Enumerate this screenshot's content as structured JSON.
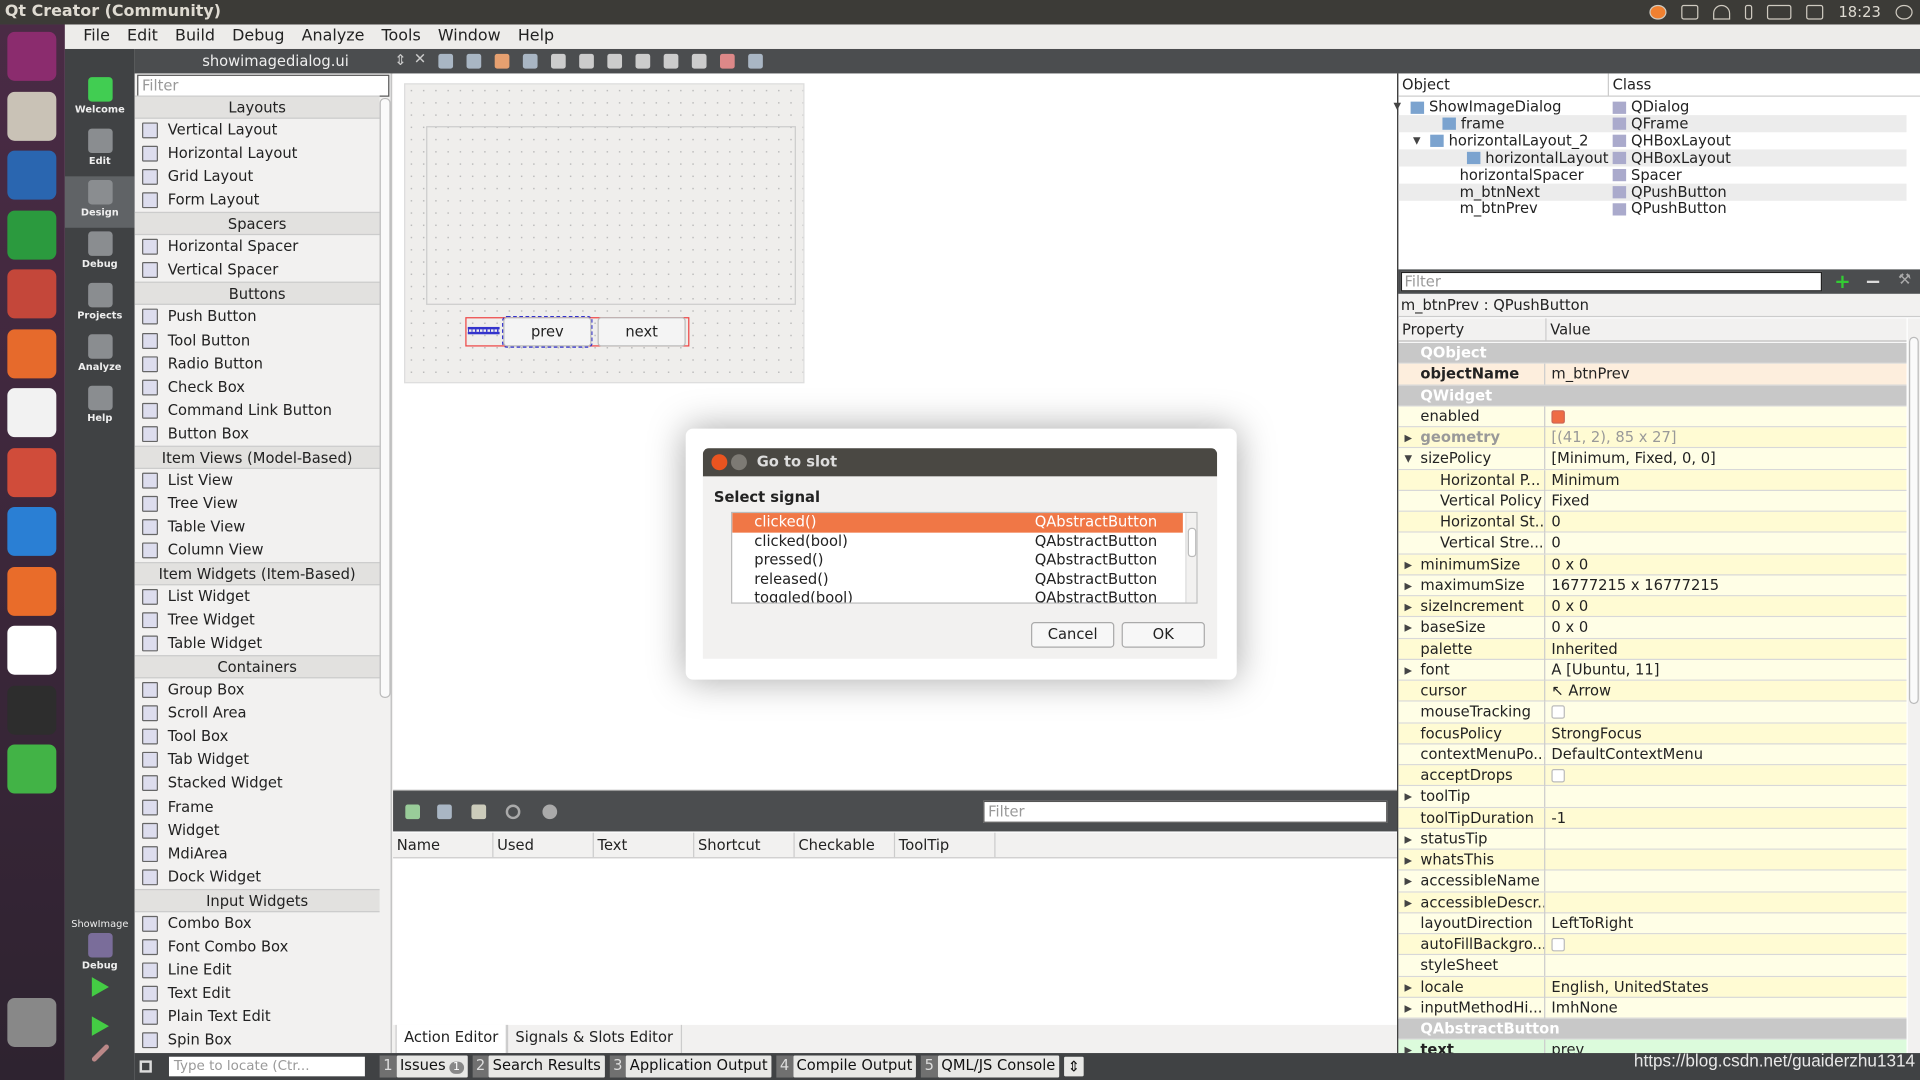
{
  "window": {
    "title": "Qt Creator (Community)",
    "clock": "18:23"
  },
  "launcher": [
    "ubuntu-dash",
    "files",
    "writer",
    "calc",
    "impress",
    "software-center",
    "amazon",
    "system-settings",
    "vscode",
    "ubuntu-updates",
    "chrome",
    "terminal",
    "qt-creator",
    "trash"
  ],
  "menu": [
    "File",
    "Edit",
    "Build",
    "Debug",
    "Analyze",
    "Tools",
    "Window",
    "Help"
  ],
  "modes": [
    "Welcome",
    "Edit",
    "Design",
    "Debug",
    "Projects",
    "Analyze",
    "Help"
  ],
  "target": {
    "project": "ShowImage",
    "config": "Debug"
  },
  "editor": {
    "document": "showimagedialog.ui"
  },
  "widgetbox": {
    "filter_placeholder": "Filter",
    "rows": [
      {
        "cat": "Layouts"
      },
      {
        "label": "Vertical Layout"
      },
      {
        "label": "Horizontal Layout"
      },
      {
        "label": "Grid Layout"
      },
      {
        "label": "Form Layout"
      },
      {
        "cat": "Spacers"
      },
      {
        "label": "Horizontal Spacer"
      },
      {
        "label": "Vertical Spacer"
      },
      {
        "cat": "Buttons"
      },
      {
        "label": "Push Button"
      },
      {
        "label": "Tool Button"
      },
      {
        "label": "Radio Button"
      },
      {
        "label": "Check Box"
      },
      {
        "label": "Command Link Button"
      },
      {
        "label": "Button Box"
      },
      {
        "cat": "Item Views (Model-Based)"
      },
      {
        "label": "List View"
      },
      {
        "label": "Tree View"
      },
      {
        "label": "Table View"
      },
      {
        "label": "Column View"
      },
      {
        "cat": "Item Widgets (Item-Based)"
      },
      {
        "label": "List Widget"
      },
      {
        "label": "Tree Widget"
      },
      {
        "label": "Table Widget"
      },
      {
        "cat": "Containers"
      },
      {
        "label": "Group Box"
      },
      {
        "label": "Scroll Area"
      },
      {
        "label": "Tool Box"
      },
      {
        "label": "Tab Widget"
      },
      {
        "label": "Stacked Widget"
      },
      {
        "label": "Frame"
      },
      {
        "label": "Widget"
      },
      {
        "label": "MdiArea"
      },
      {
        "label": "Dock Widget"
      },
      {
        "cat": "Input Widgets"
      },
      {
        "label": "Combo Box"
      },
      {
        "label": "Font Combo Box"
      },
      {
        "label": "Line Edit"
      },
      {
        "label": "Text Edit"
      },
      {
        "label": "Plain Text Edit"
      },
      {
        "label": "Spin Box"
      }
    ]
  },
  "form": {
    "prev": "prev",
    "next": "next"
  },
  "action_editor": {
    "filter_placeholder": "Filter",
    "columns": [
      "Name",
      "Used",
      "Text",
      "Shortcut",
      "Checkable",
      "ToolTip"
    ],
    "tabs": [
      "Action Editor",
      "Signals & Slots Editor"
    ]
  },
  "object_inspector": {
    "columns": [
      "Object",
      "Class"
    ],
    "rows": [
      {
        "object": "ShowImageDialog",
        "class": "QDialog",
        "depth": 0,
        "expanded": true
      },
      {
        "object": "frame",
        "class": "QFrame",
        "depth": 1
      },
      {
        "object": "horizontalLayout_2",
        "class": "QHBoxLayout",
        "depth": 1,
        "expanded": true
      },
      {
        "object": "horizontalLayout",
        "class": "QHBoxLayout",
        "depth": 2
      },
      {
        "object": "horizontalSpacer",
        "class": "Spacer",
        "depth": 2
      },
      {
        "object": "m_btnNext",
        "class": "QPushButton",
        "depth": 2
      },
      {
        "object": "m_btnPrev",
        "class": "QPushButton",
        "depth": 2
      }
    ]
  },
  "property_editor": {
    "filter_placeholder": "Filter",
    "selected": "m_btnPrev : QPushButton",
    "columns": [
      "Property",
      "Value"
    ],
    "rows": [
      {
        "group": "QObject"
      },
      {
        "name": "objectName",
        "value": "m_btnPrev",
        "bold": true
      },
      {
        "group": "QWidget"
      },
      {
        "name": "enabled",
        "check": true
      },
      {
        "name": "geometry",
        "value": "[(41, 2), 85 x 27]",
        "arrow": "right",
        "dim": true
      },
      {
        "name": "sizePolicy",
        "value": "[Minimum, Fixed, 0, 0]",
        "arrow": "down"
      },
      {
        "name": "Horizontal P...",
        "value": "Minimum",
        "sub": true
      },
      {
        "name": "Vertical Policy",
        "value": "Fixed",
        "sub": true
      },
      {
        "name": "Horizontal St...",
        "value": "0",
        "sub": true
      },
      {
        "name": "Vertical Stre...",
        "value": "0",
        "sub": true
      },
      {
        "name": "minimumSize",
        "value": "0 x 0",
        "arrow": "right"
      },
      {
        "name": "maximumSize",
        "value": "16777215 x 16777215",
        "arrow": "right"
      },
      {
        "name": "sizeIncrement",
        "value": "0 x 0",
        "arrow": "right"
      },
      {
        "name": "baseSize",
        "value": "0 x 0",
        "arrow": "right"
      },
      {
        "name": "palette",
        "value": "Inherited"
      },
      {
        "name": "font",
        "value": "A  [Ubuntu, 11]",
        "arrow": "right"
      },
      {
        "name": "cursor",
        "value": "↖  Arrow"
      },
      {
        "name": "mouseTracking",
        "check": false
      },
      {
        "name": "focusPolicy",
        "value": "StrongFocus"
      },
      {
        "name": "contextMenuPo...",
        "value": "DefaultContextMenu"
      },
      {
        "name": "acceptDrops",
        "check": false
      },
      {
        "name": "toolTip",
        "value": "",
        "arrow": "right"
      },
      {
        "name": "toolTipDuration",
        "value": "-1"
      },
      {
        "name": "statusTip",
        "value": "",
        "arrow": "right"
      },
      {
        "name": "whatsThis",
        "value": "",
        "arrow": "right"
      },
      {
        "name": "accessibleName",
        "value": "",
        "arrow": "right"
      },
      {
        "name": "accessibleDescr...",
        "value": "",
        "arrow": "right"
      },
      {
        "name": "layoutDirection",
        "value": "LeftToRight"
      },
      {
        "name": "autoFillBackgro...",
        "check": false
      },
      {
        "name": "styleSheet",
        "value": ""
      },
      {
        "name": "locale",
        "value": "English, UnitedStates",
        "arrow": "right"
      },
      {
        "name": "inputMethodHi...",
        "value": "ImhNone",
        "arrow": "right"
      },
      {
        "group": "QAbstractButton"
      },
      {
        "name": "text",
        "value": "prev",
        "arrow": "right",
        "bold": true,
        "green": true
      }
    ]
  },
  "dialog": {
    "title": "Go to slot",
    "heading": "Select signal",
    "signals": [
      {
        "signal": "clicked()",
        "class": "QAbstractButton",
        "selected": true
      },
      {
        "signal": "clicked(bool)",
        "class": "QAbstractButton"
      },
      {
        "signal": "pressed()",
        "class": "QAbstractButton"
      },
      {
        "signal": "released()",
        "class": "QAbstractButton"
      },
      {
        "signal": "toggled(bool)",
        "class": "QAbstractButton"
      }
    ],
    "cancel": "Cancel",
    "ok": "OK"
  },
  "statusbar": {
    "locate_placeholder": "Type to locate (Ctr...",
    "panes": [
      {
        "num": "1",
        "label": "Issues",
        "badge": "1"
      },
      {
        "num": "2",
        "label": "Search Results"
      },
      {
        "num": "3",
        "label": "Application Output"
      },
      {
        "num": "4",
        "label": "Compile Output"
      },
      {
        "num": "5",
        "label": "QML/JS Console"
      }
    ]
  },
  "watermark": "https://blog.csdn.net/guaiderzhu1314",
  "colors": {
    "accent": "#f07746",
    "property_bg": "#fffbd3",
    "group_bg": "#c8c8c8"
  }
}
